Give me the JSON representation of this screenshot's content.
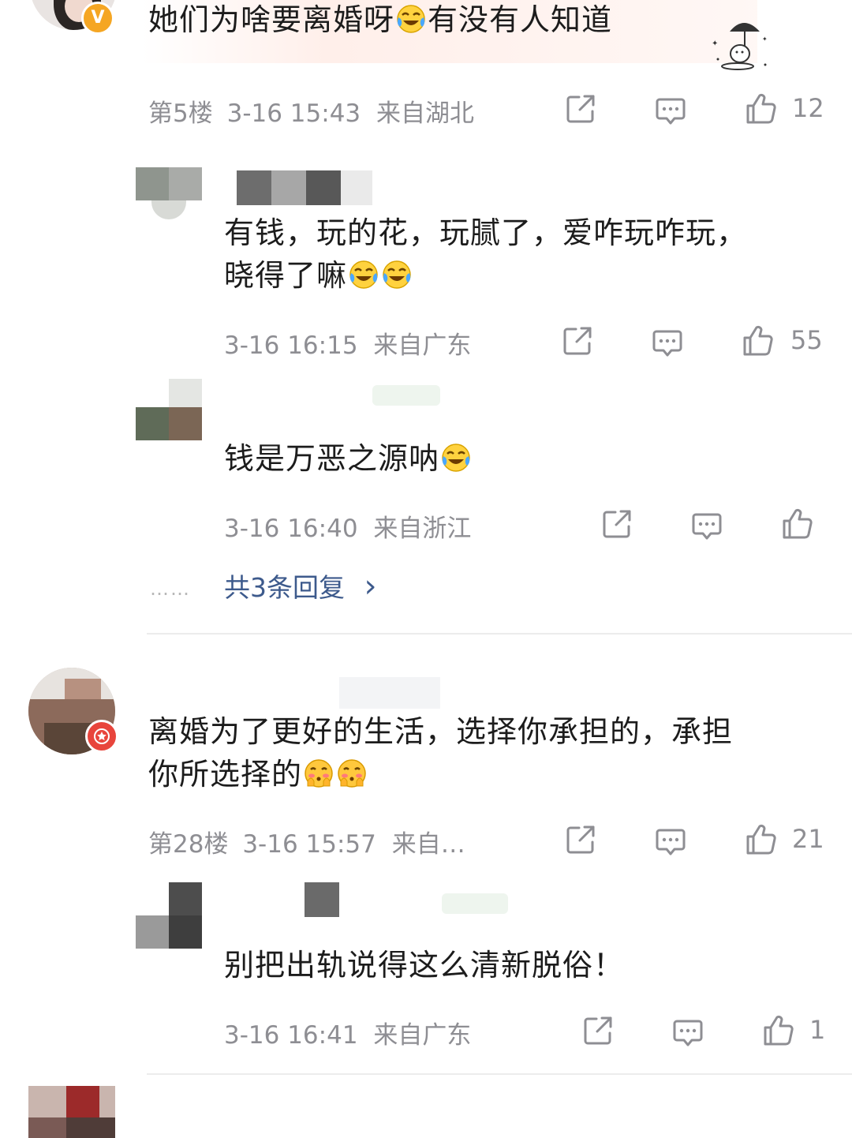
{
  "comments": [
    {
      "text_line1": "她们为啥要离婚呀",
      "text_line1_after": "有没有人知道",
      "floor": "第5楼",
      "time": "3-16 15:43",
      "location": "来自湖北",
      "likes": "12",
      "badge_letter": "V",
      "replies": [
        {
          "text_line1": "有钱，玩的花，玩腻了，爱咋玩咋玩，",
          "text_line2": "晓得了嘛",
          "time": "3-16 16:15",
          "location": "来自广东",
          "likes": "55"
        },
        {
          "text_line1": "钱是万恶之源呐",
          "time": "3-16 16:40",
          "location": "来自浙江",
          "likes": ""
        }
      ],
      "more_dots": "……",
      "more_replies": "共3条回复",
      "more_chevron": "›"
    },
    {
      "text_line1": "离婚为了更好的生活，选择你承担的，承担",
      "text_line2": "你所选择的",
      "floor": "第28楼",
      "time": "3-16 15:57",
      "location": "来自…",
      "likes": "21",
      "replies": [
        {
          "text_line1": "别把出轨说得这么清新脱俗！",
          "time": "3-16 16:41",
          "location": "来自广东",
          "likes": "1"
        }
      ]
    }
  ],
  "icons": {
    "share": "share-icon",
    "comment": "comment-icon",
    "like": "thumbs-up-icon",
    "emoji_cry_laugh": "crying-laughing-emoji",
    "emoji_shy": "shy-emoji"
  },
  "colors": {
    "meta_gray": "#8e8e93",
    "link_blue": "#3d5a8c",
    "badge_orange": "#f5a623",
    "badge_red": "#e8453c"
  }
}
